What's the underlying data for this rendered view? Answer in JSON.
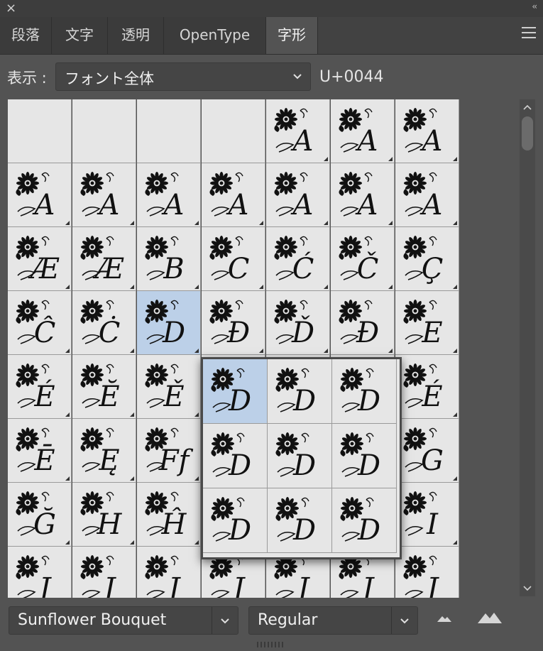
{
  "window": {
    "close_glyph": "×",
    "collapse_glyph": "‹‹"
  },
  "tabs": [
    {
      "label": "段落",
      "active": false
    },
    {
      "label": "文字",
      "active": false
    },
    {
      "label": "透明",
      "active": false
    },
    {
      "label": "OpenType",
      "active": false
    },
    {
      "label": "字形",
      "active": true
    }
  ],
  "toolbar": {
    "show_label": "表示 :",
    "show_value": "フォント全体",
    "unicode_readout": "U+0044"
  },
  "grid": {
    "selected_letter": "D",
    "rows": [
      [
        "",
        "",
        "",
        "",
        "A",
        "A",
        "A"
      ],
      [
        "A",
        "A",
        "A",
        "A",
        "A",
        "A",
        "A"
      ],
      [
        "Æ",
        "Æ",
        "B",
        "C",
        "Ć",
        "Č",
        "Ç"
      ],
      [
        "Ĉ",
        "Ċ",
        "D",
        "Đ",
        "Ď",
        "Đ",
        "E"
      ],
      [
        "É",
        "Ĕ",
        "Ě",
        "",
        "",
        "",
        "É"
      ],
      [
        "Ē",
        "Ę",
        "Ff",
        "",
        "",
        "",
        "G"
      ],
      [
        "Ğ",
        "H",
        "Ĥ",
        "",
        "",
        "",
        "I"
      ],
      [
        "J",
        "J",
        "J",
        "J",
        "J",
        "J",
        "J"
      ]
    ]
  },
  "popup": {
    "letters": [
      "D",
      "D",
      "D",
      "D",
      "D",
      "D",
      "D",
      "D",
      "D"
    ]
  },
  "footer": {
    "font_family": "Sunflower Bouquet",
    "font_style": "Regular"
  },
  "colors": {
    "panel_bg": "#535353",
    "cell_bg": "#e6e6e6",
    "selected_bg": "#bcd0e8"
  },
  "icons": {
    "close": "close-icon",
    "menu": "hamburger-menu-icon",
    "zoom_out": "mountain-small-icon",
    "zoom_in": "mountain-large-icon"
  }
}
